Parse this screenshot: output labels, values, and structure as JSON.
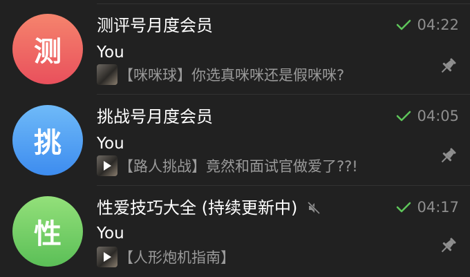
{
  "chats": [
    {
      "avatar_letter": "测",
      "avatar_gradient": [
        "#f57f6d",
        "#e8505a"
      ],
      "title": "测评号月度会员",
      "muted": false,
      "time": "04:22",
      "sender": "You",
      "preview": "【咪咪球】你选真咪咪还是假咪咪?",
      "thumb_has_play": false,
      "pinned": true
    },
    {
      "avatar_letter": "挑",
      "avatar_gradient": [
        "#6cb7f8",
        "#3e8ef0"
      ],
      "title": "挑战号月度会员",
      "muted": false,
      "time": "04:05",
      "sender": "You",
      "preview": "【路人挑战】竟然和面试官做爱了??!",
      "thumb_has_play": true,
      "pinned": true
    },
    {
      "avatar_letter": "性",
      "avatar_gradient": [
        "#8ede74",
        "#5cc058"
      ],
      "title": "性爱技巧大全 (持续更新中)",
      "muted": true,
      "time": "04:17",
      "sender": "You",
      "preview": "【人形炮机指南】",
      "thumb_has_play": true,
      "pinned": true
    }
  ],
  "colors": {
    "background": "#212121",
    "check": "#5ec55a",
    "muted_text": "#8e8e8e",
    "preview_text": "#9a9a9a"
  },
  "icons": {
    "read": "double-check-icon",
    "pin": "pin-icon",
    "mute": "mute-speaker-icon",
    "play": "play-icon"
  }
}
